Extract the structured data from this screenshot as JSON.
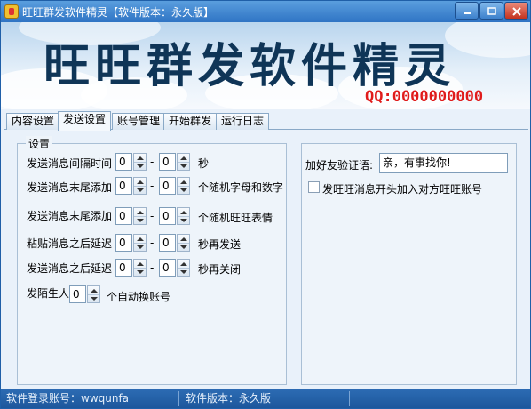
{
  "window": {
    "title": "旺旺群发软件精灵【软件版本：永久版】",
    "buttons": {
      "minimize": "−",
      "maximize": "□",
      "close": "✕"
    }
  },
  "banner": {
    "title": "旺旺群发软件精灵",
    "qq": "QQ:0000000000",
    "colors": {
      "title": "#0f3557",
      "qq": "#e01b1b"
    }
  },
  "tabs": [
    {
      "label": "内容设置",
      "active": false
    },
    {
      "label": "发送设置",
      "active": true
    },
    {
      "label": "账号管理",
      "active": false
    },
    {
      "label": "开始群发",
      "active": false
    },
    {
      "label": "运行日志",
      "active": false
    }
  ],
  "settings": {
    "group_title": "设置",
    "rows": [
      {
        "label": "发送消息间隔时间",
        "from": "0",
        "to": "0",
        "suffix": "秒"
      },
      {
        "label": "发送消息末尾添加",
        "from": "0",
        "to": "0",
        "suffix": "个随机字母和数字"
      },
      {
        "label": "发送消息末尾添加",
        "from": "0",
        "to": "0",
        "suffix": "个随机旺旺表情"
      },
      {
        "label": "粘贴消息之后延迟",
        "from": "0",
        "to": "0",
        "suffix": "秒再发送"
      },
      {
        "label": "发送消息之后延迟",
        "from": "0",
        "to": "0",
        "suffix": "秒再关闭"
      }
    ],
    "stranger_row": {
      "label": "发陌生人",
      "value": "0",
      "suffix": "个自动换账号"
    },
    "separator": "-"
  },
  "friend_verify": {
    "label": "加好友验证语:",
    "value": "亲，有事找你!",
    "checkbox_label": "发旺旺消息开头加入对方旺旺账号",
    "checked": false
  },
  "statusbar": {
    "account": "软件登录账号：wwqunfa",
    "version": "软件版本：永久版"
  }
}
